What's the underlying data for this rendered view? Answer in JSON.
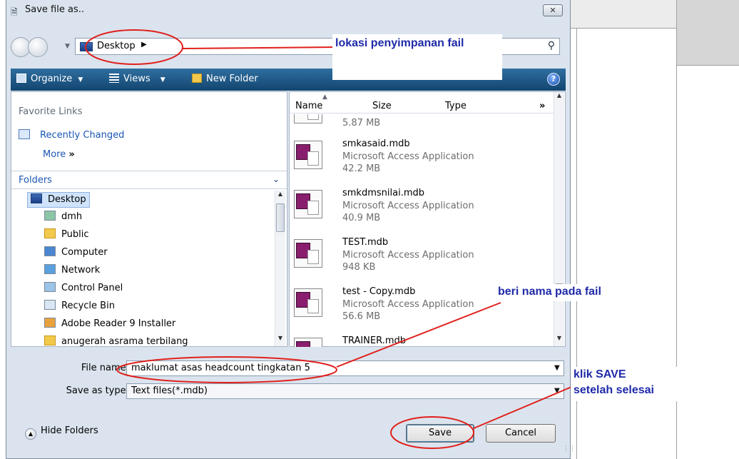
{
  "dialog": {
    "title": "Save file as..",
    "close_label": "✕"
  },
  "address": {
    "location": "Desktop",
    "arrow": "▶"
  },
  "toolbar": {
    "organize": "Organize",
    "views": "Views",
    "new_folder": "New Folder",
    "dropdown_glyph": "▼",
    "help": "?"
  },
  "favorites": {
    "title": "Favorite Links",
    "items": [
      {
        "label": "Recently Changed"
      }
    ],
    "more": "More",
    "more_glyph": "»"
  },
  "folders": {
    "title": "Folders",
    "chevron": "⌄",
    "items": [
      {
        "label": "Desktop"
      },
      {
        "label": "dmh"
      },
      {
        "label": "Public"
      },
      {
        "label": "Computer"
      },
      {
        "label": "Network"
      },
      {
        "label": "Control Panel"
      },
      {
        "label": "Recycle Bin"
      },
      {
        "label": "Adobe Reader 9 Installer"
      },
      {
        "label": "anugerah asrama terbilang"
      }
    ]
  },
  "columns": {
    "name": "Name",
    "size": "Size",
    "type": "Type",
    "more": "»"
  },
  "files": [
    {
      "name": "",
      "type": "",
      "size": "5.87 MB"
    },
    {
      "name": "smkasaid.mdb",
      "type": "Microsoft Access Application",
      "size": "42.2 MB"
    },
    {
      "name": "smkdmsnilai.mdb",
      "type": "Microsoft Access Application",
      "size": "40.9 MB"
    },
    {
      "name": "TEST.mdb",
      "type": "Microsoft Access Application",
      "size": "948 KB"
    },
    {
      "name": "test - Copy.mdb",
      "type": "Microsoft Access Application",
      "size": "56.6 MB"
    },
    {
      "name": "TRAINER.mdb",
      "type": "",
      "size": ""
    }
  ],
  "form": {
    "file_name_label": "File name:",
    "file_name_value": "maklumat asas headcount tingkatan 5",
    "save_type_label": "Save as type:",
    "save_type_value": "Text files(*.mdb)",
    "dropdown_glyph": "▼"
  },
  "buttons": {
    "hide_folders": "Hide Folders",
    "save": "Save",
    "cancel": "Cancel"
  },
  "annotations": {
    "location": "lokasi penyimpanan fail",
    "filename": "beri nama pada fail",
    "save_line1": "klik SAVE",
    "save_line2": "setelah selesai"
  },
  "colors": {
    "annotation_text": "#1f2aa8",
    "annotation_ellipse": "#e0201c",
    "toolbar": "#1d5584",
    "link": "#1a56b4"
  }
}
